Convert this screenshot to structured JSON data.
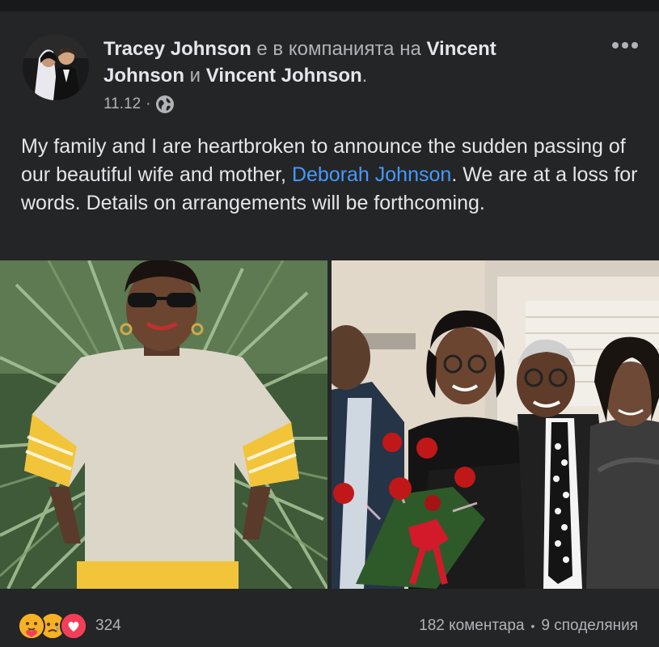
{
  "post": {
    "author": "Tracey Johnson",
    "with_text": "е в компанията на",
    "tagged_1": "Vincent Johnson",
    "and_text": "и",
    "tagged_2": "Vincent Johnson",
    "end_punct": ".",
    "timestamp": "11.12",
    "separator": "·",
    "privacy_icon": "globe-icon",
    "more_icon": "more-horizontal-icon",
    "text_before_mention": "My family and I are heartbroken to announce the sudden passing of our beautiful wife and mother,",
    "mention": "Deborah Johnson",
    "text_after_mention": ". We are at a loss for words. Details on arrangements will be forthcoming."
  },
  "reactions": {
    "icons": [
      "care-icon",
      "sad-icon",
      "love-icon"
    ],
    "count": "324"
  },
  "stats": {
    "comments": "182 коментара",
    "dot": "•",
    "shares": "9 споделяния"
  },
  "colors": {
    "background": "#242526",
    "text": "#e4e6eb",
    "secondary": "#b0b3b8",
    "mention": "#4599ff",
    "love": "#f33e58",
    "reaction_yellow": "#f7b125"
  }
}
